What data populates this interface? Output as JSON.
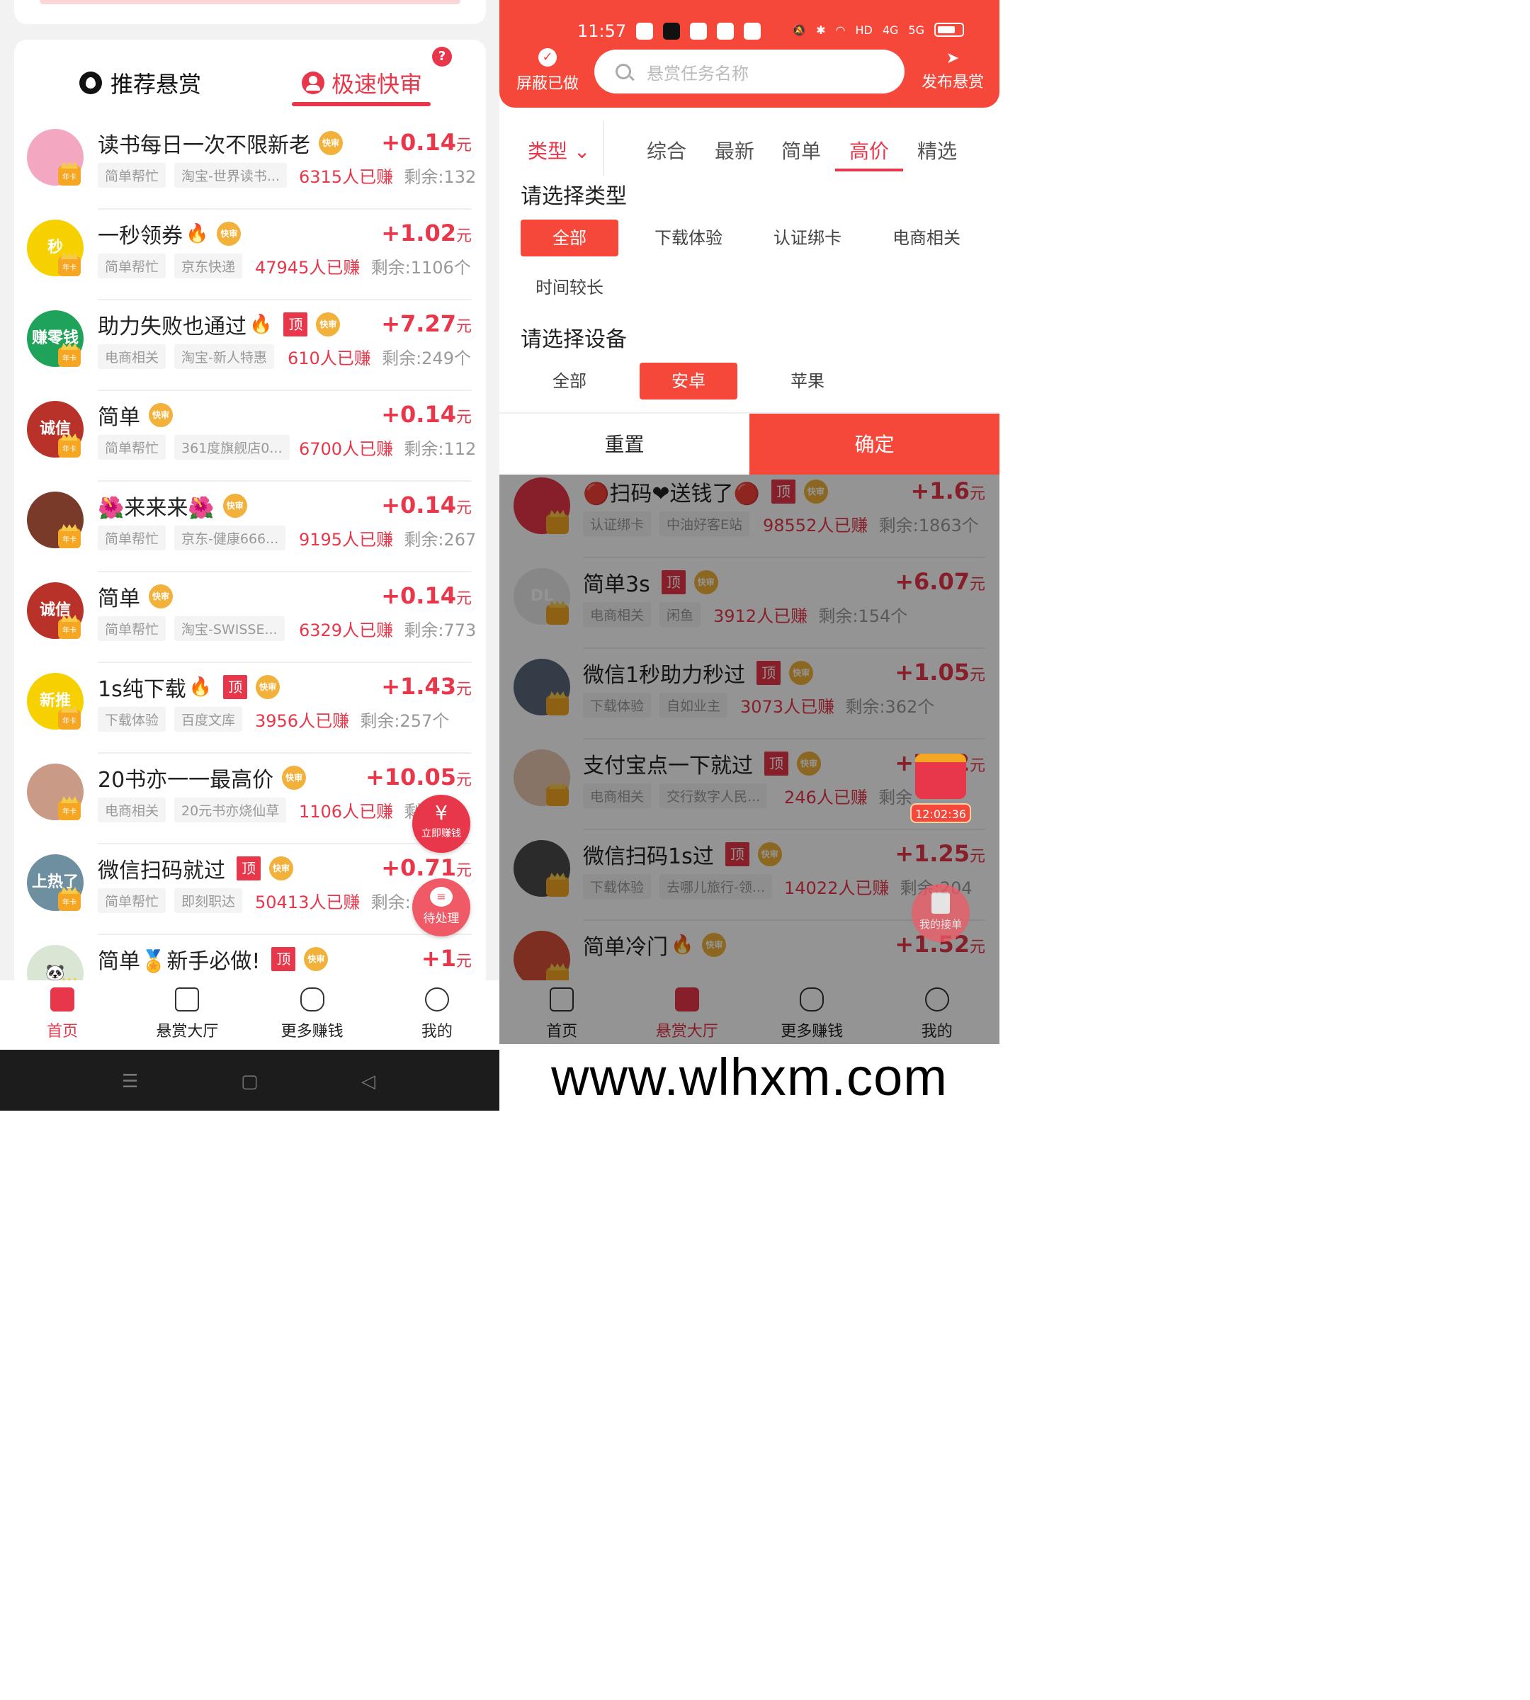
{
  "left": {
    "ghost_status": "11:57",
    "tabs": {
      "recommend": "推荐悬赏",
      "fast": "极速快审",
      "help": "?"
    },
    "badges": {
      "top": "顶",
      "fast": "快审",
      "nianka": "年卡"
    },
    "rows": [
      {
        "title": "读书每日一次不限新老",
        "fire": false,
        "top": false,
        "price": "+0.14",
        "unit": "元",
        "tags": [
          "简单帮忙",
          "淘宝-世界读书..."
        ],
        "earned": "6315人已赚",
        "remain": "剩余:132",
        "avatar_color": "#f3a7c0"
      },
      {
        "title": "一秒领券",
        "fire": true,
        "top": false,
        "price": "+1.02",
        "unit": "元",
        "tags": [
          "简单帮忙",
          "京东快递"
        ],
        "earned": "47945人已赚",
        "remain": "剩余:1106个",
        "avatar_color": "#f7d000",
        "avatar_text": "秒"
      },
      {
        "title": "助力失败也通过",
        "fire": true,
        "top": true,
        "price": "+7.27",
        "unit": "元",
        "tags": [
          "电商相关",
          "淘宝-新人特惠"
        ],
        "earned": "610人已赚",
        "remain": "剩余:249个",
        "avatar_color": "#1fa35a",
        "avatar_text": "赚零钱"
      },
      {
        "title": "简单",
        "fire": false,
        "top": false,
        "price": "+0.14",
        "unit": "元",
        "tags": [
          "简单帮忙",
          "361度旗舰店0..."
        ],
        "earned": "6700人已赚",
        "remain": "剩余:112",
        "avatar_color": "#b8322a",
        "avatar_text": "诚信"
      },
      {
        "title": "🌺来来来🌺",
        "fire": false,
        "top": false,
        "price": "+0.14",
        "unit": "元",
        "tags": [
          "简单帮忙",
          "京东-健康666..."
        ],
        "earned": "9195人已赚",
        "remain": "剩余:267",
        "avatar_color": "#7a3a2a"
      },
      {
        "title": "简单",
        "fire": false,
        "top": false,
        "price": "+0.14",
        "unit": "元",
        "tags": [
          "简单帮忙",
          "淘宝-SWISSE..."
        ],
        "earned": "6329人已赚",
        "remain": "剩余:773",
        "avatar_color": "#b8322a",
        "avatar_text": "诚信"
      },
      {
        "title": "1s纯下载",
        "fire": true,
        "top": true,
        "price": "+1.43",
        "unit": "元",
        "tags": [
          "下载体验",
          "百度文库"
        ],
        "earned": "3956人已赚",
        "remain": "剩余:257个",
        "avatar_color": "#f7d000",
        "avatar_text": "新推"
      },
      {
        "title": "20书亦一一最高价",
        "fire": false,
        "top": false,
        "price": "+10.05",
        "unit": "元",
        "tags": [
          "电商相关",
          "20元书亦烧仙草"
        ],
        "earned": "1106人已赚",
        "remain": "剩",
        "avatar_color": "#c99a86"
      },
      {
        "title": "微信扫码就过",
        "fire": false,
        "top": true,
        "price": "+0.71",
        "unit": "元",
        "tags": [
          "简单帮忙",
          "即刻职达"
        ],
        "earned": "50413人已赚",
        "remain": "剩余:",
        "avatar_color": "#6d8fa0",
        "avatar_text": "上热了"
      },
      {
        "title": "简单🏅新手必做!",
        "fire": false,
        "top": true,
        "price": "+1",
        "unit": "元",
        "tags": [],
        "earned": "",
        "remain": "",
        "avatar_color": "#d9e6d4",
        "avatar_text": "🐼"
      }
    ],
    "fab_earn": {
      "symbol": "¥",
      "label": "立即赚钱"
    },
    "fab_pending": {
      "symbol": "≡",
      "label": "待处理"
    },
    "nav": [
      "首页",
      "悬赏大厅",
      "更多赚钱",
      "我的"
    ],
    "sys_nav": [
      "☰",
      "▢",
      "◁"
    ]
  },
  "right": {
    "status_time": "11:57",
    "status_icons": [
      "HD",
      "4G",
      "5G"
    ],
    "hide_done": "屏蔽已做",
    "search_placeholder": "悬赏任务名称",
    "publish": "发布悬赏",
    "type_filter": "类型",
    "sorts": [
      "综合",
      "最新",
      "简单",
      "高价",
      "精选"
    ],
    "active_sort": "高价",
    "section_type": "请选择类型",
    "types": [
      "全部",
      "下载体验",
      "认证绑卡",
      "电商相关",
      "时间较长"
    ],
    "section_device": "请选择设备",
    "devices": [
      "全部",
      "安卓",
      "苹果"
    ],
    "reset": "重置",
    "confirm": "确定",
    "rows": [
      {
        "title": "🔴扫码❤送钱了🔴",
        "top": true,
        "fire": false,
        "price": "+1.6",
        "unit": "元",
        "tags": [
          "认证绑卡",
          "中油好客E站"
        ],
        "earned": "98552人已赚",
        "remain": "剩余:1863个",
        "avatar_color": "#e8364a"
      },
      {
        "title": "简单3s",
        "top": true,
        "fire": false,
        "price": "+6.07",
        "unit": "元",
        "tags": [
          "电商相关",
          "闲鱼"
        ],
        "earned": "3912人已赚",
        "remain": "剩余:154个",
        "avatar_color": "#e9e9e9",
        "avatar_text": "DL"
      },
      {
        "title": "微信1秒助力秒过",
        "top": true,
        "fire": false,
        "price": "+1.05",
        "unit": "元",
        "tags": [
          "下载体验",
          "自如业主"
        ],
        "earned": "3073人已赚",
        "remain": "剩余:362个",
        "avatar_color": "#5a6a7a"
      },
      {
        "title": "支付宝点一下就过",
        "top": true,
        "fire": false,
        "price": "+7.12",
        "unit": "元",
        "tags": [
          "电商相关",
          "交行数字人民..."
        ],
        "earned": "246人已赚",
        "remain": "剩余",
        "avatar_color": "#e8c8b0"
      },
      {
        "title": "微信扫码1s过",
        "top": true,
        "fire": false,
        "price": "+1.25",
        "unit": "元",
        "tags": [
          "下载体验",
          "去哪儿旅行-领..."
        ],
        "earned": "14022人已赚",
        "remain": "剩余:204",
        "avatar_color": "#4a4a4a"
      },
      {
        "title": "简单冷门",
        "top": false,
        "fire": true,
        "price": "+1.52",
        "unit": "元",
        "tags": [],
        "earned": "",
        "remain": "",
        "avatar_color": "#d8503a"
      }
    ],
    "redpack_timer": "12:02:36",
    "my_orders": "我的接单",
    "nav": [
      "首页",
      "悬赏大厅",
      "更多赚钱",
      "我的"
    ],
    "watermark": "www.wlhxm.com"
  }
}
